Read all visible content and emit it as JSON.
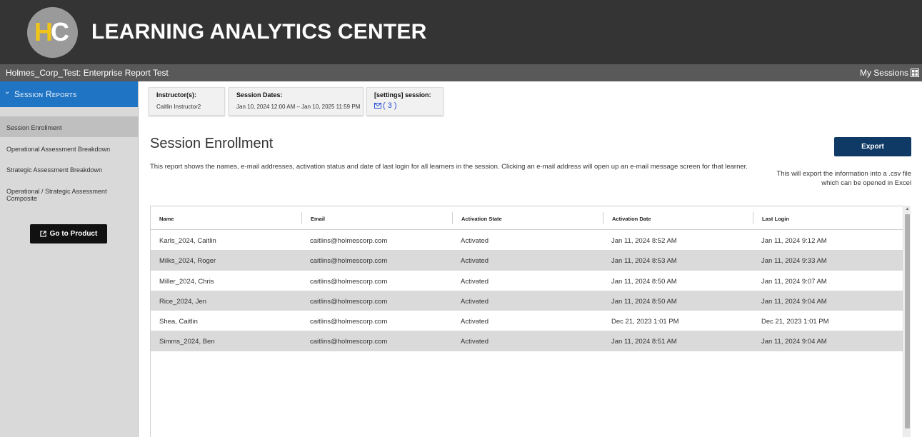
{
  "header": {
    "logo": {
      "letter_h": "H",
      "letter_c": "C",
      "accent_color": "#f0c419"
    },
    "title": "LEARNING ANALYTICS CENTER"
  },
  "subbar": {
    "breadcrumb": "Holmes_Corp_Test: Enterprise Report Test",
    "my_sessions": "My Sessions",
    "my_sessions_icon": "grid-icon"
  },
  "sidebar": {
    "section_title": "Session Reports",
    "section_icon": "chevron-down-icon",
    "items": [
      {
        "label": "Session Enrollment",
        "active": true
      },
      {
        "label": "Operational Assessment Breakdown",
        "active": false
      },
      {
        "label": "Strategic Assessment Breakdown",
        "active": false
      },
      {
        "label": "Operational / Strategic Assessment  Composite",
        "active": false
      }
    ],
    "go_button": "Go to Product",
    "go_button_icon": "external-link-icon"
  },
  "info_cards": {
    "instructors": {
      "title": "Instructor(s):",
      "value": "Caitlin Instructor2"
    },
    "dates": {
      "title": "Session Dates:",
      "value": "Jan 10, 2024 12:00 AM – Jan 10, 2025 11:59 PM"
    },
    "settings": {
      "title": "[settings] session:",
      "value": "( 3 )",
      "icon": "mail-icon"
    }
  },
  "main": {
    "title": "Session Enrollment",
    "description": "This report shows the names, e-mail addresses, activation status and date of last login for all learners in the session. Clicking an e-mail address will open up an e-mail message screen for that learner.",
    "export_button": "Export",
    "export_note_line1": "This will export the information into a .csv file",
    "export_note_line2": "which can be opened in Excel",
    "brand_color": "#0f3a66",
    "accent_color": "#1f74c4"
  },
  "table": {
    "columns": [
      "Name",
      "Email",
      "Activation State",
      "Activation Date",
      "Last Login"
    ],
    "rows": [
      [
        "Karls_2024, Caitlin",
        "caitlins@holmescorp.com",
        "Activated",
        "Jan 11, 2024 8:52 AM",
        "Jan 11, 2024 9:12 AM"
      ],
      [
        "Milks_2024, Roger",
        "caitlins@holmescorp.com",
        "Activated",
        "Jan 11, 2024 8:53 AM",
        "Jan 11, 2024 9:33 AM"
      ],
      [
        "Miller_2024, Chris",
        "caitlins@holmescorp.com",
        "Activated",
        "Jan 11, 2024 8:50 AM",
        "Jan 11, 2024 9:07 AM"
      ],
      [
        "Rice_2024, Jen",
        "caitlins@holmescorp.com",
        "Activated",
        "Jan 11, 2024 8:50 AM",
        "Jan 11, 2024 9:04 AM"
      ],
      [
        "Shea, Caitlin",
        "caitlins@holmescorp.com",
        "Activated",
        "Dec 21, 2023 1:01 PM",
        "Dec 21, 2023 1:01 PM"
      ],
      [
        "Simms_2024, Ben",
        "caitlins@holmescorp.com",
        "Activated",
        "Jan 11, 2024 8:51 AM",
        "Jan 11, 2024 9:04 AM"
      ]
    ]
  }
}
